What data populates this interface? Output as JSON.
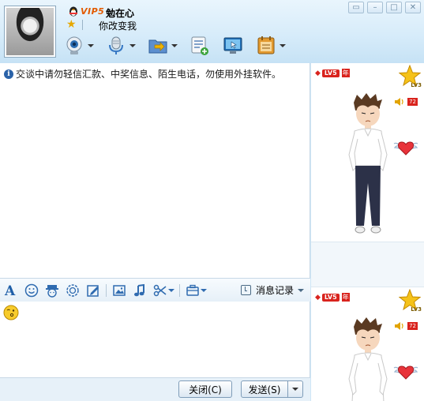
{
  "window": {
    "contact_name": "勉在心",
    "vip_label": "VIP5",
    "signature": "你改变我",
    "controls": [
      "restore-icon",
      "minimize-icon",
      "maximize-icon",
      "close-icon"
    ]
  },
  "toolbar": {
    "items": [
      {
        "icon": "webcam-icon",
        "has_dropdown": true
      },
      {
        "icon": "microphone-icon",
        "has_dropdown": true
      },
      {
        "icon": "send-file-icon",
        "has_dropdown": true
      },
      {
        "icon": "sms-icon",
        "has_dropdown": false
      },
      {
        "icon": "remote-assist-icon",
        "has_dropdown": false
      },
      {
        "icon": "app-box-icon",
        "has_dropdown": true
      }
    ]
  },
  "chat": {
    "notice": "交谈中请勿轻信汇款、中奖信息、陌生电话，勿使用外挂软件。"
  },
  "input_toolbar": {
    "icons": [
      "font-icon",
      "emoticon-icon",
      "magic-face-icon",
      "shake-icon",
      "scrawl-icon",
      "image-icon",
      "music-icon",
      "screenshot-icon",
      "apps-icon"
    ],
    "history_label": "消息记录"
  },
  "footer": {
    "close_label": "关闭(C)",
    "send_label": "发送(S)"
  },
  "show_panel": {
    "level_badge": "LV5",
    "year_badge": "年",
    "star_level": "LV3",
    "score": "72"
  },
  "colors": {
    "accent_red": "#d9231d",
    "vip_orange": "#e25a00",
    "panel_blue": "#cfe6f6"
  }
}
